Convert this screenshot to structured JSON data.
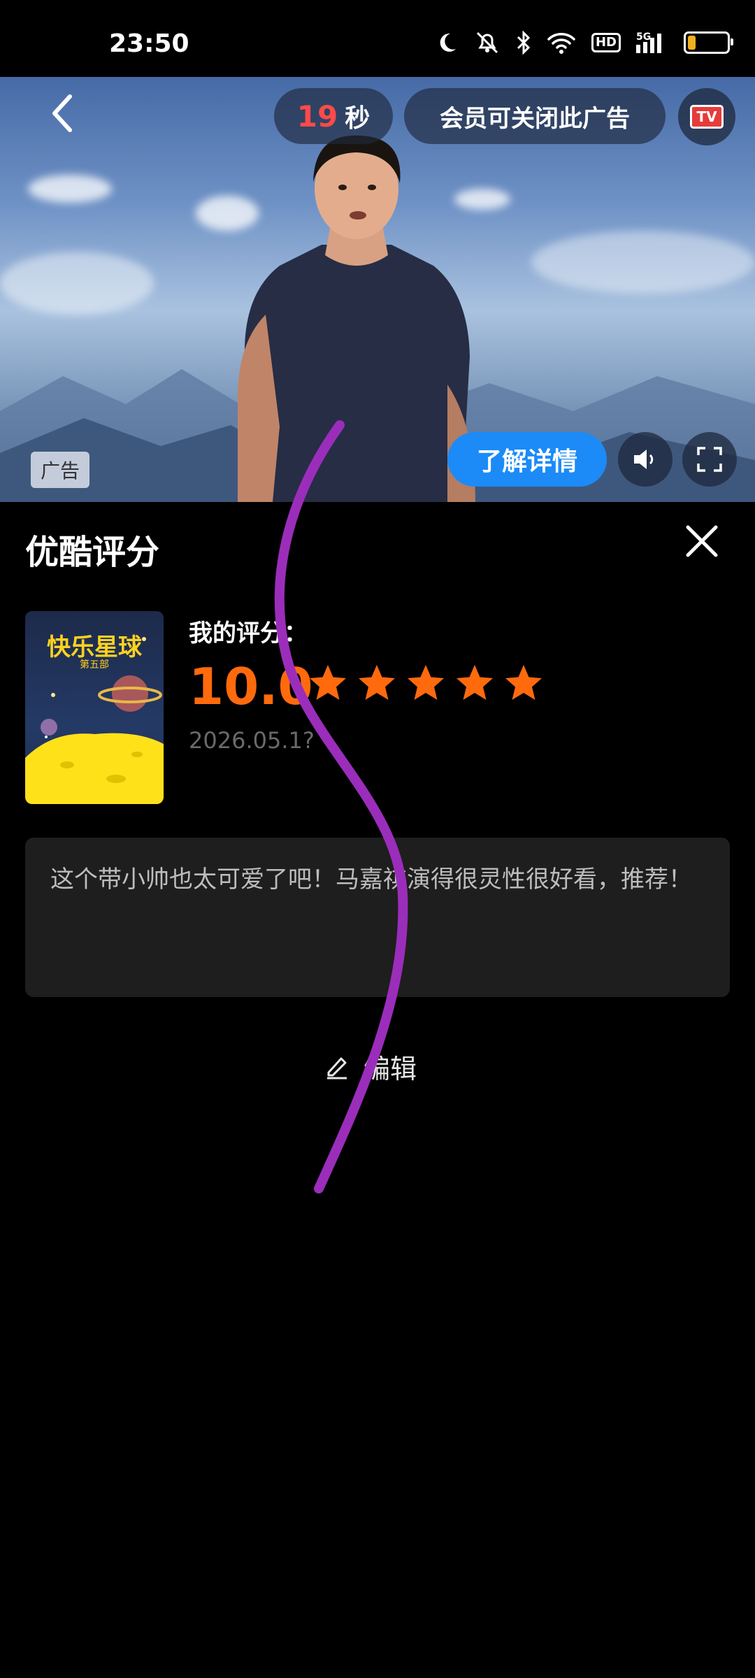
{
  "status_bar": {
    "time": "23:50",
    "icons": [
      "moon-icon",
      "mute-icon",
      "bluetooth-icon",
      "wifi-icon",
      "hd-icon",
      "signal-5g-icon",
      "battery-icon"
    ],
    "hd_label": "HD",
    "network_label": "5G",
    "battery_level": 0.22
  },
  "ad": {
    "countdown": "19",
    "countdown_unit": "秒",
    "vip_close_text": "会员可关闭此广告",
    "tv_badge": "TV",
    "ad_label": "广告",
    "detail_button": "了解详情"
  },
  "rating": {
    "title": "优酷评分",
    "poster_title": "快乐星球",
    "poster_subtitle": "第五部",
    "my_rating_label": "我的评分：",
    "score": "10.0",
    "stars": 5,
    "date": "2026.05.1?",
    "comment": "这个带小帅也太可爱了吧！马嘉祺演得很灵性很好看，推荐！",
    "edit_label": "编辑"
  },
  "colors": {
    "accent": "#ff6a0d",
    "countdown": "#ff4a4a",
    "detail_button": "#1c8bf7",
    "scribble": "#9b2dbb"
  }
}
